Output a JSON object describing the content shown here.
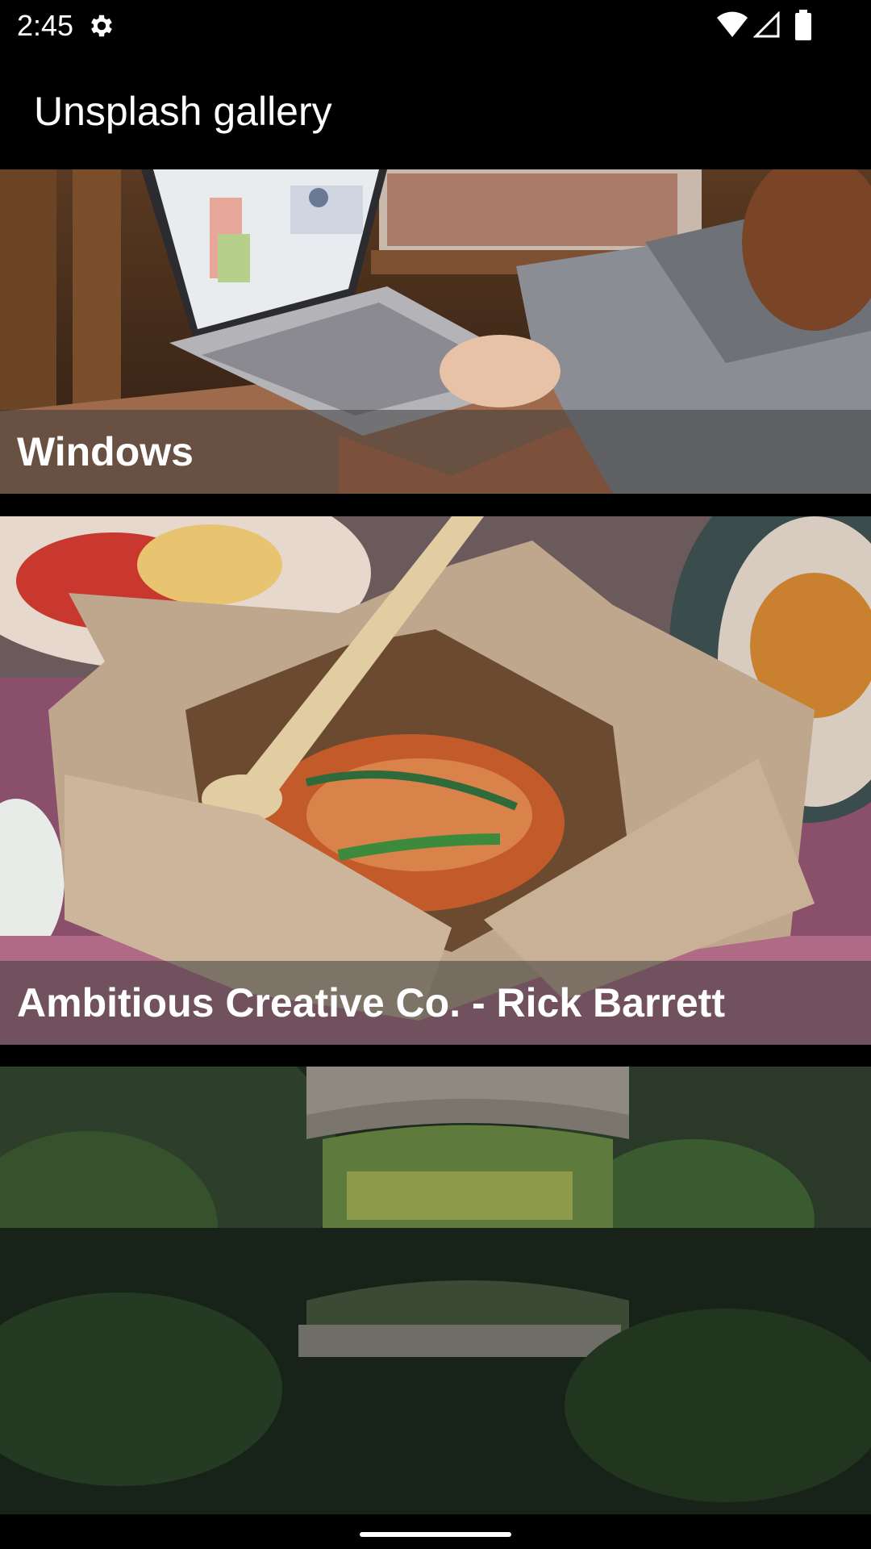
{
  "status_bar": {
    "time": "2:45",
    "icons": [
      "gear-icon",
      "wifi-icon",
      "signal-icon",
      "battery-icon"
    ]
  },
  "app_bar": {
    "title": "Unsplash gallery"
  },
  "gallery": {
    "items": [
      {
        "caption": "Windows",
        "image": "laptop-photo"
      },
      {
        "caption": "Ambitious Creative Co.  - Rick Barrett",
        "image": "food-box-photo"
      },
      {
        "caption": "",
        "image": "bridge-river-photo"
      }
    ]
  },
  "colors": {
    "background": "#000000",
    "text": "#ffffff",
    "caption_band": "rgba(60,60,60,0.55)"
  }
}
